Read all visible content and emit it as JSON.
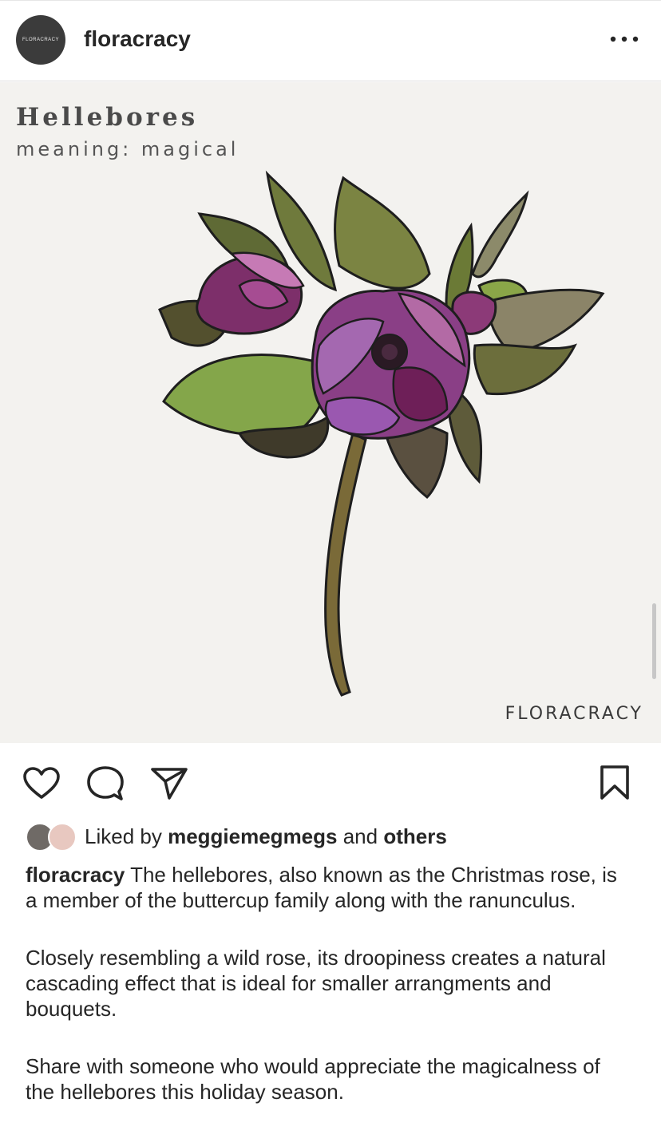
{
  "header": {
    "avatar_text": "FLORACRACY",
    "username": "floracracy",
    "more_icon": "more-horizontal-icon"
  },
  "post": {
    "flower_title": "Hellebores",
    "flower_meaning": "meaning: magical",
    "watermark": "FLORACRACY",
    "colors": {
      "background": "#f3f2ef",
      "petal": "#8a3f7e",
      "leaf": "#6e7a3a",
      "stem": "#7a6a38"
    }
  },
  "actions": {
    "like_icon": "heart-icon",
    "comment_icon": "comment-icon",
    "share_icon": "send-icon",
    "save_icon": "bookmark-icon"
  },
  "likes": {
    "prefix": "Liked by",
    "user": "meggiemegmegs",
    "conjunction": "and",
    "others": "others"
  },
  "caption": {
    "username": "floracracy",
    "paragraph1": "The hellebores, also known as the Christmas rose, is a member of the buttercup family along with the ranunculus.",
    "paragraph2": "Closely resembling a wild rose, its droopiness creates a natural cascading effect that is ideal for smaller arrangments and bouquets.",
    "paragraph3": "Share with someone who would appreciate the magicalness of the hellebores this holiday season."
  }
}
